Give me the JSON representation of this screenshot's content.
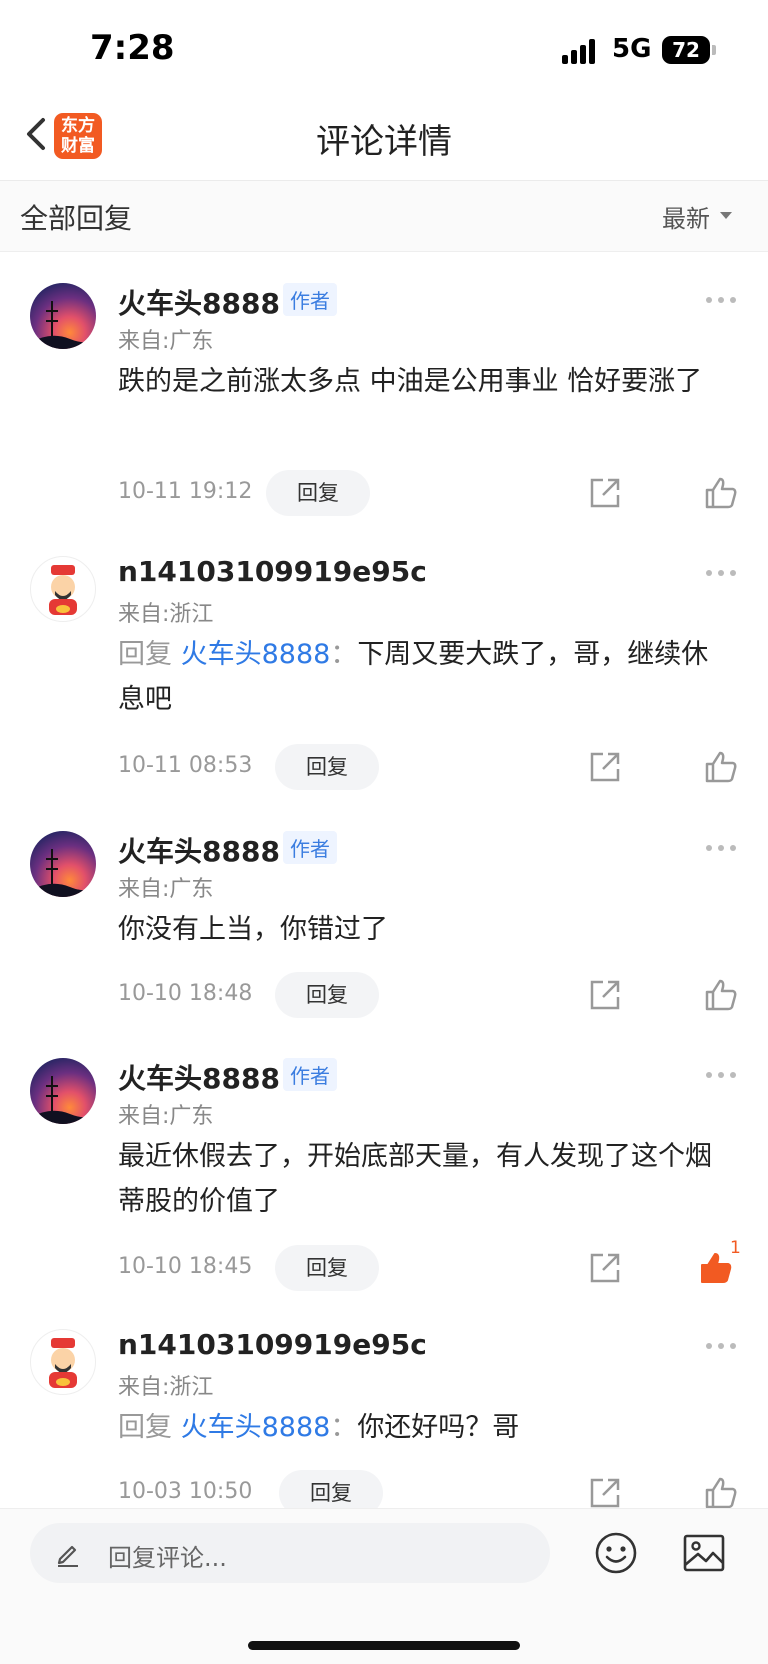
{
  "status_bar": {
    "time": "7:28",
    "network": "5G",
    "battery": "72"
  },
  "nav": {
    "logo_line1": "东方",
    "logo_line2": "财富",
    "title": "评论详情"
  },
  "filter": {
    "title": "全部回复",
    "sort_label": "最新"
  },
  "comments": [
    {
      "username": "火车头8888",
      "badge": "作者",
      "location": "来自:广东",
      "content": "跌的是之前涨太多点  中油是公用事业 恰好要涨了",
      "time": "10-11 19:12",
      "reply_label": "回复"
    },
    {
      "username": "n14103109919e95c",
      "location": "来自:浙江",
      "reply_prefix": "回复",
      "reply_to": "火车头8888",
      "reply_colon": "：",
      "content": "下周又要大跌了，哥，继续休息吧",
      "time": "10-11 08:53",
      "reply_label": "回复"
    },
    {
      "username": "火车头8888",
      "badge": "作者",
      "location": "来自:广东",
      "content": "你没有上当，你错过了",
      "time": "10-10 18:48",
      "reply_label": "回复"
    },
    {
      "username": "火车头8888",
      "badge": "作者",
      "location": "来自:广东",
      "content": "最近休假去了，开始底部天量，有人发现了这个烟蒂股的价值了",
      "time": "10-10 18:45",
      "reply_label": "回复",
      "like_count": "1",
      "liked": true
    },
    {
      "username": "n14103109919e95c",
      "location": "来自:浙江",
      "reply_prefix": "回复",
      "reply_to": "火车头8888",
      "reply_colon": "：",
      "content": "你还好吗？哥",
      "time": "10-03 10:50",
      "reply_label": "回复"
    }
  ],
  "bottom_bar": {
    "placeholder": "回复评论..."
  },
  "colors": {
    "accent": "#f25a22",
    "link": "#2f7ae5",
    "badge_text": "#3b7de0"
  }
}
